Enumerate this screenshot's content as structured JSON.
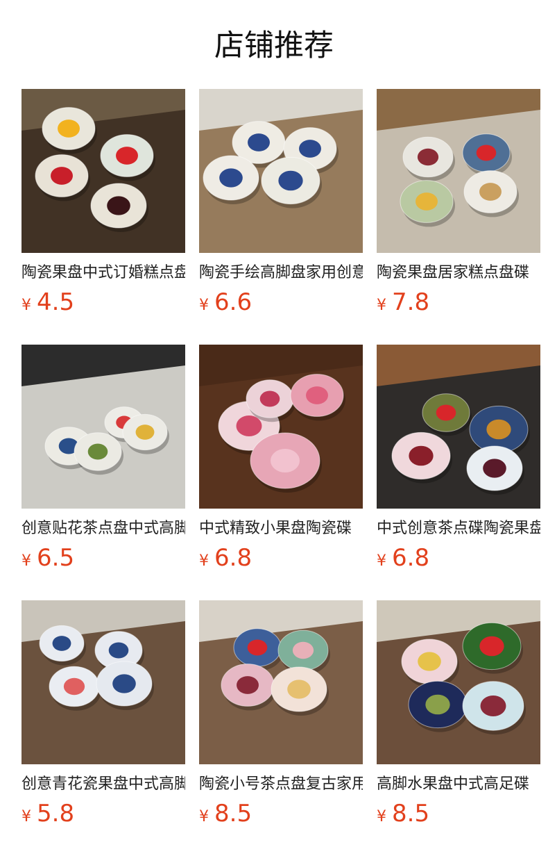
{
  "page": {
    "title": "店铺推荐"
  },
  "colors": {
    "price": "#e2401c",
    "title_text": "#111111",
    "name_text": "#222222"
  },
  "products": [
    {
      "name": "陶瓷果盘中式订婚糕点盘",
      "currency": "¥",
      "price": "4.5",
      "image": {
        "scene": "four-lobed-dishes-on-rattan-tray",
        "bg": "#6b5a44",
        "mat": "#3a2c20",
        "dishes": [
          "#e9e6db",
          "#dfe5dc",
          "#e8e2d6",
          "#e9e4d8"
        ],
        "food": [
          "#f2b21f",
          "#d8262a",
          "#c81f2a",
          "#3a1518"
        ]
      }
    },
    {
      "name": "陶瓷手绘高脚盘家用创意",
      "currency": "¥",
      "price": "6.6",
      "image": {
        "scene": "calligraphy-footed-bowls",
        "bg": "#d9d5cc",
        "mat": "#8a6b48",
        "dishes": [
          "#efece4",
          "#eeebe3",
          "#efece5",
          "#ecebe2"
        ],
        "food": [
          "#2c4a8e",
          "#2c4a8e",
          "#2c4a8e",
          "#2c4a8e"
        ]
      }
    },
    {
      "name": "陶瓷果盘居家糕点盘碟",
      "currency": "¥",
      "price": "7.8",
      "image": {
        "scene": "glazed-footed-plates",
        "bg": "#8b6a46",
        "mat": "#cfcac0",
        "dishes": [
          "#e8e6df",
          "#4f6f95",
          "#b9c9a2",
          "#eeebe4"
        ],
        "food": [
          "#8b2c36",
          "#d8262a",
          "#e6b53a",
          "#caa060"
        ]
      }
    },
    {
      "name": "创意贴花茶点盘中式高脚",
      "currency": "¥",
      "price": "6.5",
      "image": {
        "scene": "painted-footed-bowls",
        "bg": "#2c2c2c",
        "mat": "#e9e7e1",
        "dishes": [
          "#ecebe4",
          "#edece6",
          "#ecebe5",
          "#ebeae3"
        ],
        "food": [
          "#2a4f8a",
          "#d83a3a",
          "#e0b23a",
          "#6a8a3a"
        ]
      }
    },
    {
      "name": "中式精致小果盘陶瓷碟",
      "currency": "¥",
      "price": "6.8",
      "image": {
        "scene": "pink-lotus-dishes",
        "bg": "#4a2a18",
        "mat": "#5b3520",
        "dishes": [
          "#f0d6db",
          "#ecd2d8",
          "#e79fb0",
          "#e7a6b6"
        ],
        "food": [
          "#d24a6a",
          "#c23a5a",
          "#e0607e",
          "#f2c2cf"
        ]
      }
    },
    {
      "name": "中式创意茶点碟陶瓷果盘",
      "currency": "¥",
      "price": "6.8",
      "image": {
        "scene": "flower-plates-on-runner",
        "bg": "#8a5a36",
        "mat": "#1f2428",
        "dishes": [
          "#6f7a3a",
          "#2f4a7a",
          "#f0d8dc",
          "#e9eef2"
        ],
        "food": [
          "#d8262a",
          "#c98a2a",
          "#8a1f2a",
          "#5a1a2a"
        ]
      }
    },
    {
      "name": "创意青花瓷果盘中式高脚",
      "currency": "¥",
      "price": "5.8",
      "image": {
        "scene": "blue-white-footed-bowls",
        "bg": "#c9c4ba",
        "mat": "#5a3e28",
        "dishes": [
          "#e9ecf1",
          "#e7eaf0",
          "#eaedf2",
          "#e5e9ef"
        ],
        "food": [
          "#2a4a86",
          "#2a4a86",
          "#e06060",
          "#2a4a86"
        ]
      }
    },
    {
      "name": "陶瓷小号茶点盘复古家用",
      "currency": "¥",
      "price": "8.5",
      "image": {
        "scene": "pastel-footed-bowls",
        "bg": "#d8d2c8",
        "mat": "#6b4a30",
        "dishes": [
          "#3d5f9a",
          "#7fb09a",
          "#e6b8c4",
          "#f2e2d8"
        ],
        "food": [
          "#d8262a",
          "#e8b0b8",
          "#8a2a3a",
          "#e6c070"
        ]
      }
    },
    {
      "name": "高脚水果盘中式高足碟",
      "currency": "¥",
      "price": "8.5",
      "image": {
        "scene": "scalloped-color-plates",
        "bg": "#cfc8ba",
        "mat": "#5a3a24",
        "dishes": [
          "#f0d4d8",
          "#2e6a2a",
          "#1e2a5a",
          "#cfe4ea"
        ],
        "food": [
          "#e6c24a",
          "#d8262a",
          "#8aa04a",
          "#8a2a3a"
        ]
      }
    }
  ]
}
